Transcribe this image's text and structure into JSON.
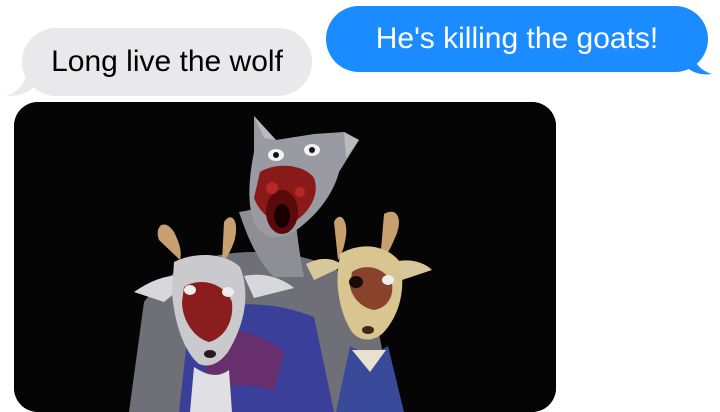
{
  "messages": {
    "received_text": "Long live the wolf",
    "sent_text": "He's killing the goats!"
  },
  "image": {
    "subject": "wolf-and-goats-illustration"
  },
  "colors": {
    "sent_bubble": "#1a8cff",
    "received_bubble": "#e9e9eb",
    "image_background": "#050505"
  }
}
